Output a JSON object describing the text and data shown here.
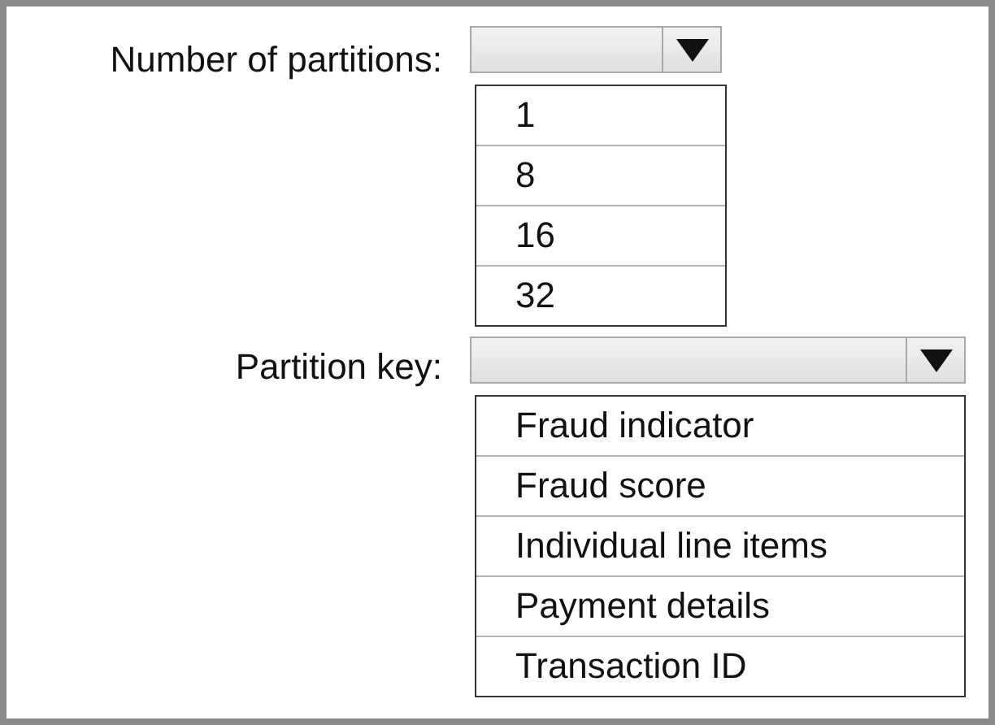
{
  "dropdowns": [
    {
      "label": "Number of partitions:",
      "options": [
        "1",
        "8",
        "16",
        "32"
      ]
    },
    {
      "label": "Partition key:",
      "options": [
        "Fraud indicator",
        "Fraud score",
        "Individual line items",
        "Payment details",
        "Transaction ID"
      ]
    }
  ]
}
